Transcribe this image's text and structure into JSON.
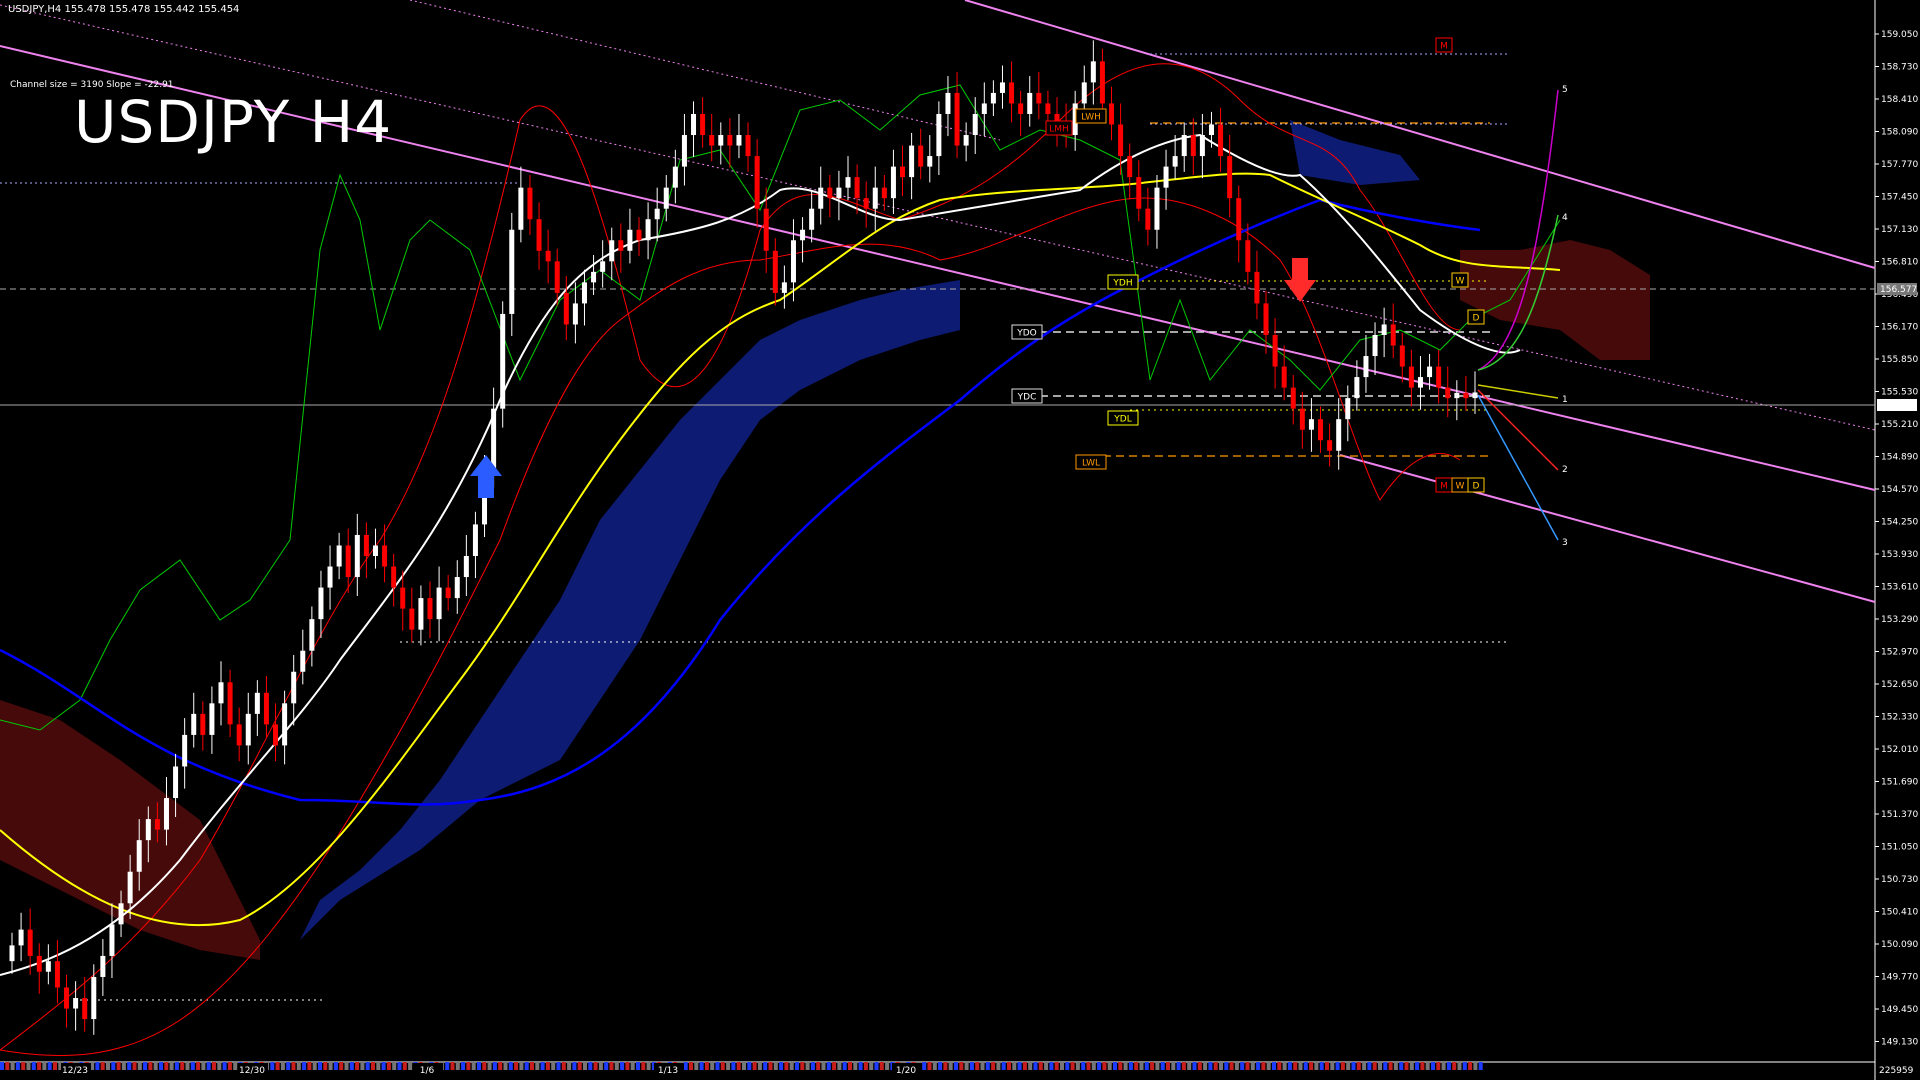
{
  "header": {
    "symbol_info": "USDJPY,H4  155.478 155.478 155.442 155.454",
    "channel_info": "Channel size = 3190 Slope = -22.91",
    "title": "USDJPY H4"
  },
  "price_axis": {
    "ticks": [
      "159.050",
      "158.730",
      "158.410",
      "158.090",
      "157.770",
      "157.450",
      "157.130",
      "156.810",
      "156.490",
      "156.170",
      "155.850",
      "155.530",
      "155.210",
      "154.890",
      "154.570",
      "154.250",
      "153.930",
      "153.610",
      "153.290",
      "152.970",
      "152.650",
      "152.330",
      "152.010",
      "151.690",
      "151.370",
      "151.050",
      "150.730",
      "150.410",
      "150.090",
      "149.770",
      "149.450",
      "149.130"
    ],
    "current_price": "155.454",
    "marker_price": "156.577"
  },
  "time_axis": {
    "labels": [
      "12/23",
      "12/30",
      "1/6",
      "1/13",
      "1/20"
    ],
    "corner_label": "225959"
  },
  "level_tags": {
    "ydo": "YDO",
    "ydc": "YDC",
    "ydh": "YDH",
    "ydl": "YDL",
    "lwh": "LWH",
    "lwl": "LWL",
    "lmh": "LMH",
    "m_top": "M",
    "w_right": "W",
    "d_right": "D",
    "m_bottom": "M",
    "w_bottom": "W",
    "d_bottom": "D"
  },
  "projection_labels": [
    "1",
    "2",
    "3",
    "4",
    "5"
  ],
  "colors": {
    "background": "#000000",
    "bull_candle": "#ffffff",
    "bear_candle": "#ff0000",
    "channel": "#ee82ee",
    "ema_slow": "#0000ff",
    "ema_mid": "#ffff00",
    "ema_fast": "#ffffff",
    "bollinger": "#ff0000",
    "green_line": "#00cc00",
    "cloud_bull": "#1e3cff",
    "cloud_bear": "#c81e1e"
  },
  "chart_data": {
    "type": "candlestick",
    "symbol": "USDJPY",
    "timeframe": "H4",
    "ylim": [
      149.13,
      159.05
    ],
    "bars": 175,
    "closes": [
      150.2,
      150.35,
      150.1,
      149.95,
      150.05,
      149.8,
      149.6,
      149.7,
      149.5,
      149.9,
      150.1,
      150.4,
      150.6,
      150.9,
      151.2,
      151.4,
      151.3,
      151.6,
      151.9,
      152.2,
      152.4,
      152.2,
      152.5,
      152.7,
      152.3,
      152.1,
      152.4,
      152.6,
      152.3,
      152.1,
      152.5,
      152.8,
      153.0,
      153.3,
      153.6,
      153.8,
      154.0,
      153.7,
      154.1,
      153.9,
      154.0,
      153.8,
      153.6,
      153.4,
      153.2,
      153.5,
      153.3,
      153.6,
      153.5,
      153.7,
      153.9,
      154.2,
      154.7,
      155.3,
      156.2,
      157.0,
      157.4,
      157.1,
      156.8,
      156.7,
      156.4,
      156.1,
      156.3,
      156.5,
      156.6,
      156.7,
      156.9,
      156.8,
      157.0,
      156.9,
      157.1,
      157.2,
      157.4,
      157.6,
      157.9,
      158.1,
      157.9,
      157.8,
      157.9,
      157.8,
      157.9,
      157.7,
      157.2,
      156.8,
      156.4,
      156.5,
      156.9,
      157.0,
      157.2,
      157.4,
      157.3,
      157.4,
      157.5,
      157.3,
      157.2,
      157.4,
      157.3,
      157.6,
      157.5,
      157.8,
      157.6,
      157.7,
      158.1,
      158.3,
      157.8,
      157.9,
      158.1,
      158.2,
      158.3,
      158.4,
      158.2,
      158.1,
      158.3,
      158.2,
      158.1,
      158.0,
      157.9,
      158.2,
      158.4,
      158.6,
      158.2,
      158.0,
      157.7,
      157.5,
      157.2,
      157.0,
      157.4,
      157.6,
      157.7,
      157.9,
      157.7,
      157.9,
      158.0,
      157.7,
      157.3,
      156.9,
      156.6,
      156.3,
      156.0,
      155.7,
      155.5,
      155.3,
      155.1,
      155.2,
      155.0,
      154.9,
      155.2,
      155.4,
      155.6,
      155.8,
      156.0,
      156.1,
      155.9,
      155.7,
      155.5,
      155.6,
      155.7,
      155.5,
      155.4,
      155.45,
      155.4,
      155.454
    ]
  }
}
